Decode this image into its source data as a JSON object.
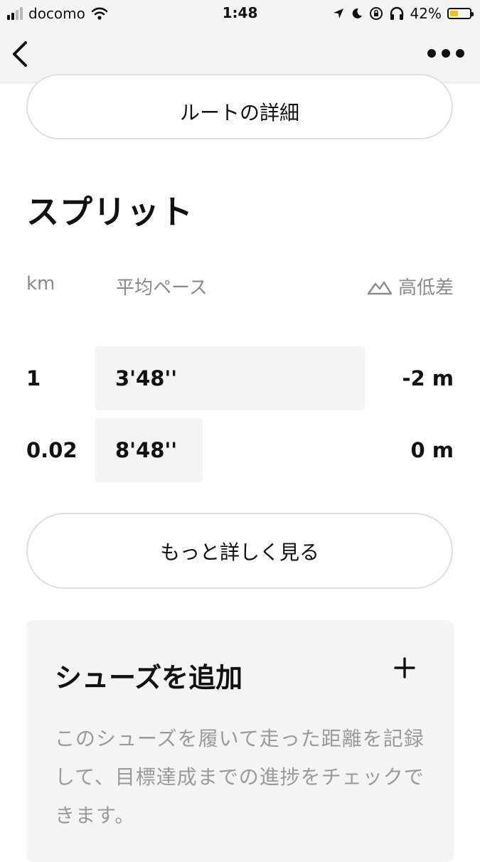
{
  "status_bar": {
    "carrier": "docomo",
    "time": "1:48",
    "battery_percent_label": "42%",
    "battery_level": 0.42,
    "signal_bars_active": 2,
    "signal_bars_total": 4,
    "icons": [
      "wifi-icon",
      "location-arrow-icon",
      "moon-icon",
      "orientation-lock-icon",
      "headphones-icon",
      "battery-icon"
    ]
  },
  "nav": {
    "back_icon": "chevron-left-icon",
    "more_icon": "more-dots-icon"
  },
  "route_button": {
    "label": "ルートの詳細"
  },
  "splits": {
    "title": "スプリット",
    "headers": {
      "km": "km",
      "pace": "平均ペース",
      "elevation": "高低差",
      "elevation_icon": "mountain-icon"
    },
    "rows": [
      {
        "km": "1",
        "pace": "3'48''",
        "pace_seconds": 228,
        "elevation": "-2 m"
      },
      {
        "km": "0.02",
        "pace": "8'48''",
        "pace_seconds": 528,
        "elevation": "0 m"
      }
    ]
  },
  "more_button": {
    "label": "もっと詳しく見る"
  },
  "shoes": {
    "title": "シューズを追加",
    "add_icon": "plus-icon",
    "description": "このシューズを履いて走った距離を記録して、目標達成までの進捗をチェックできます。"
  },
  "colors": {
    "background": "#ffffff",
    "bar_background": "#f4f4f4",
    "muted_text": "#8a8a8a",
    "battery_fill": "#f5c400"
  }
}
